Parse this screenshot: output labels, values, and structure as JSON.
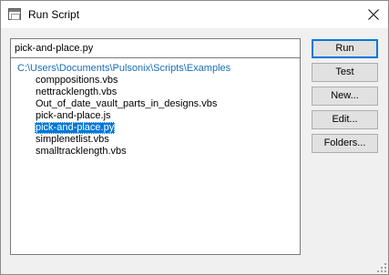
{
  "window": {
    "title": "Run Script"
  },
  "script_field": {
    "value": "pick-and-place.py"
  },
  "file_list": {
    "folder": "C:\\Users\\Documents\\Pulsonix\\Scripts\\Examples",
    "items": [
      "comppositions.vbs",
      "nettracklength.vbs",
      "Out_of_date_vault_parts_in_designs.vbs",
      "pick-and-place.js",
      "pick-and-place.py",
      "simplenetlist.vbs",
      "smalltracklength.vbs"
    ],
    "selected": "pick-and-place.py"
  },
  "buttons": {
    "run": "Run",
    "test": "Test",
    "new": "New...",
    "edit": "Edit...",
    "folders": "Folders..."
  },
  "icons": {
    "app": "window-icon",
    "close": "close-icon",
    "grip": "resize-grip-icon"
  },
  "colors": {
    "selection": "#0078d7",
    "folder_text": "#1a6eb8",
    "default_button_border": "#0078d7"
  }
}
